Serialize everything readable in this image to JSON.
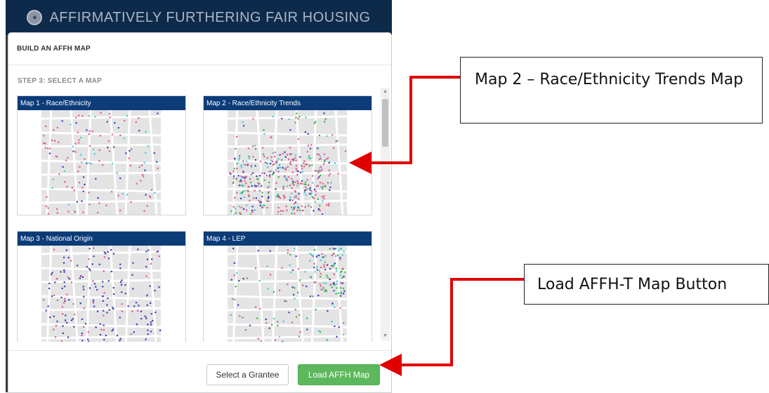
{
  "app": {
    "title": "AFFIRMATIVELY FURTHERING FAIR HOUSING",
    "seal_icon": "hud-seal-icon"
  },
  "modal": {
    "header": "BUILD AN AFFH MAP",
    "step_label": "STEP 3: SELECT A MAP",
    "maps": [
      {
        "title": "Map 1 - Race/Ethnicity"
      },
      {
        "title": "Map 2 - Race/Ethnicity Trends"
      },
      {
        "title": "Map 3 - National Origin"
      },
      {
        "title": "Map 4 - LEP"
      }
    ],
    "buttons": {
      "select_grantee": "Select a Grantee",
      "load_map": "Load AFFH Map"
    }
  },
  "callouts": {
    "map2": "Map 2 – Race/Ethnicity Trends Map",
    "load_button": "Load AFFH-T Map Button"
  },
  "colors": {
    "header_bg": "#0e2a4a",
    "card_title_bg": "#0b3c78",
    "load_button": "#5cb85c",
    "arrow": "#e00000"
  }
}
